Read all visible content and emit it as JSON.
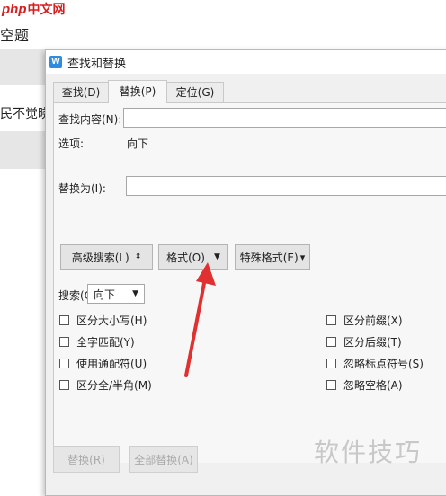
{
  "watermark_logo": {
    "prefix": "php",
    "suffix": "中文网"
  },
  "background_doc": {
    "title": "空题",
    "text": "民不觉晓"
  },
  "dialog": {
    "title": "查找和替换",
    "app_icon": "W",
    "tabs": [
      {
        "label": "查找(D)",
        "active": false
      },
      {
        "label": "替换(P)",
        "active": true
      },
      {
        "label": "定位(G)",
        "active": false
      }
    ],
    "find_label": "查找内容(N):",
    "find_value": "",
    "options_label": "选项:",
    "options_value": "向下",
    "replace_label": "替换为(I):",
    "replace_value": "",
    "buttons": {
      "advanced": "高级搜索(L)",
      "advanced_arrow": "⬍",
      "format": "格式(O)",
      "format_arrow": "▼",
      "special": "特殊格式(E)",
      "special_arrow": "▾"
    },
    "search_label": "搜索(C)",
    "search_value": "向下",
    "search_arrow": "▼",
    "checkboxes_left": [
      "区分大小写(H)",
      "全字匹配(Y)",
      "使用通配符(U)",
      "区分全/半角(M)"
    ],
    "checkboxes_right": [
      "区分前缀(X)",
      "区分后缀(T)",
      "忽略标点符号(S)",
      "忽略空格(A)"
    ],
    "bottom_buttons": {
      "replace": "替换(R)",
      "replace_all": "全部替换(A)"
    }
  },
  "watermark_text": "软件技巧",
  "colors": {
    "annotation_arrow": "#e03030",
    "logo_red": "#d61e1e",
    "icon_blue": "#2d8be0"
  }
}
